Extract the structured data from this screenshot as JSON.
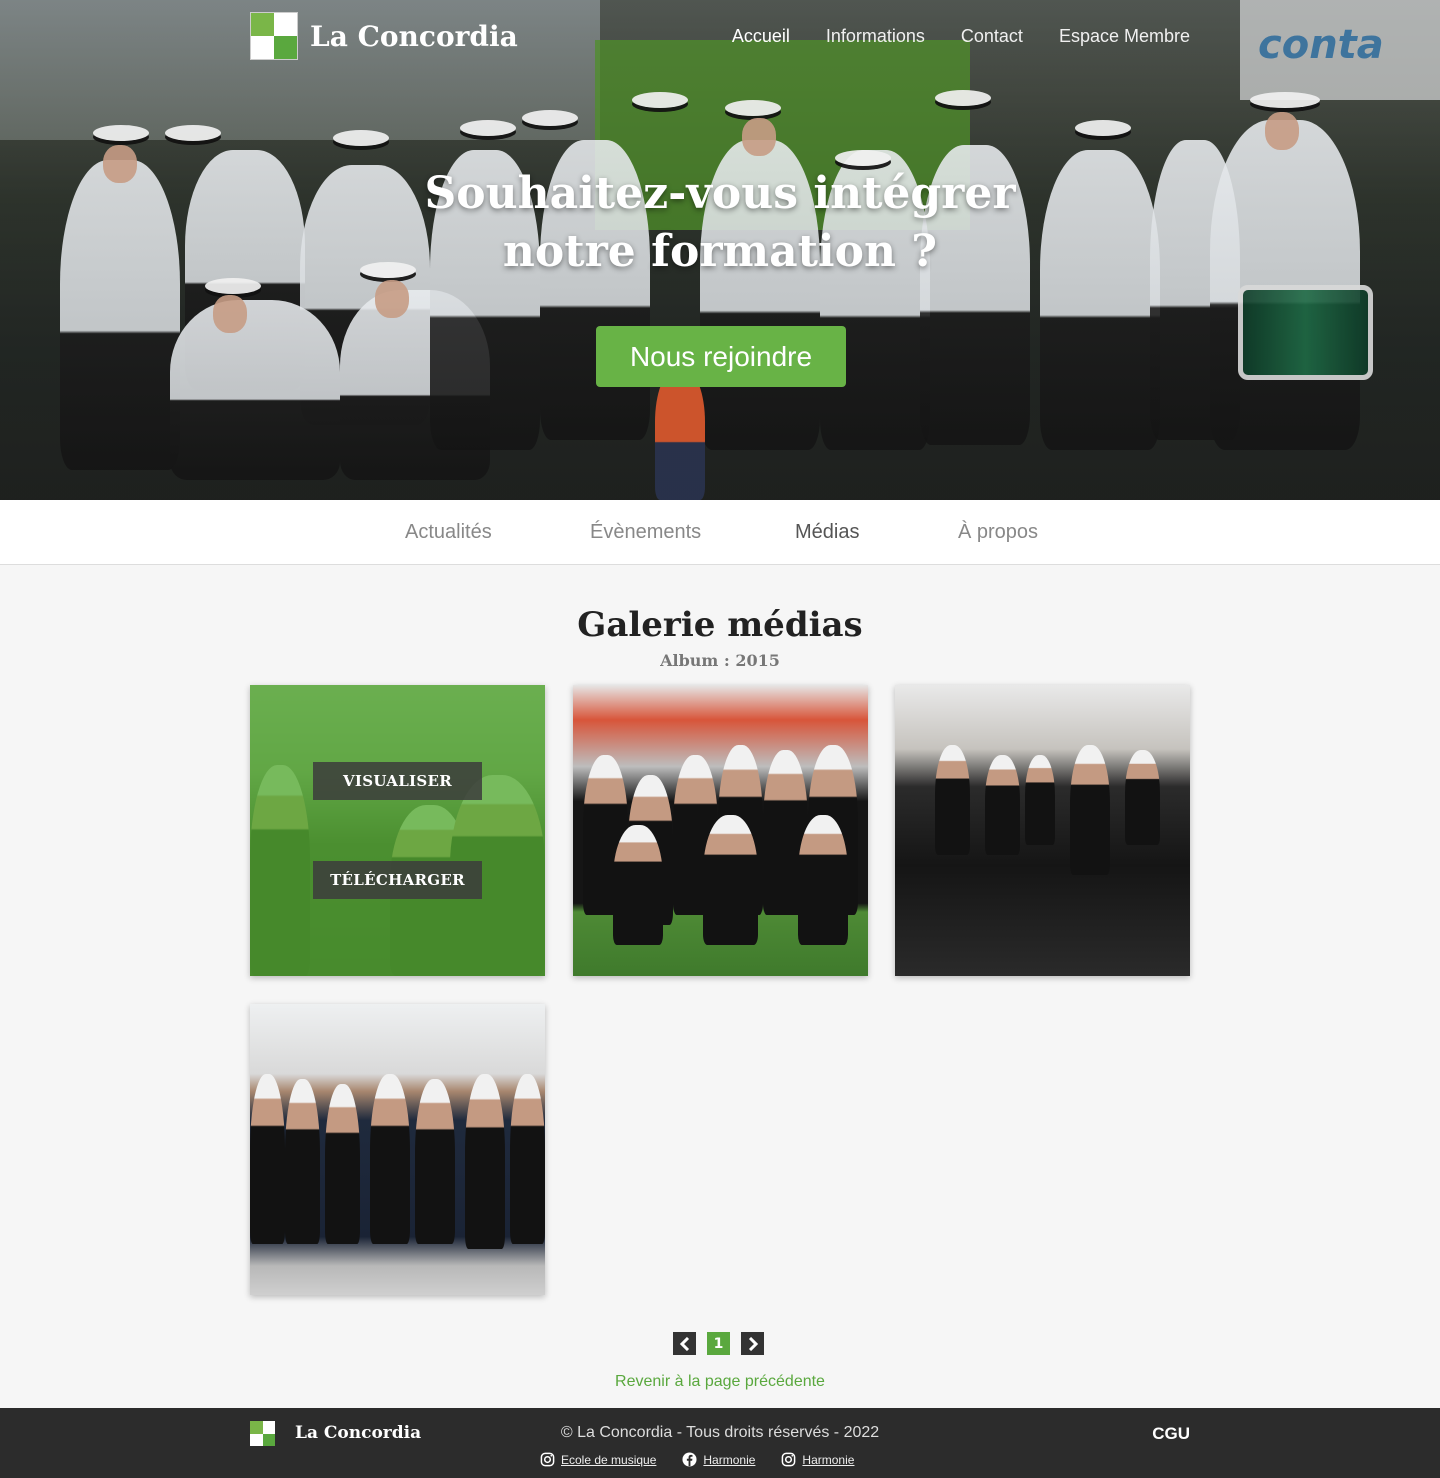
{
  "header": {
    "brand": "La Concordia",
    "nav": [
      "Accueil",
      "Informations",
      "Contact",
      "Espace Membre"
    ],
    "active_nav": "Accueil"
  },
  "hero": {
    "title_line1": "Souhaitez-vous intégrer",
    "title_line2": "notre formation ?",
    "cta": "Nous rejoindre"
  },
  "subnav": {
    "items": [
      "Actualités",
      "Évènements",
      "Médias",
      "À propos"
    ],
    "active": "Médias"
  },
  "gallery": {
    "title": "Galerie médias",
    "subtitle": "Album : 2015",
    "overlay_buttons": [
      "VISUALISER",
      "TÉLÉCHARGER"
    ]
  },
  "pagination": {
    "current_page": "1",
    "prev_icon": "chevron-left-icon",
    "next_icon": "chevron-right-icon",
    "back_link": "Revenir à la page précédente"
  },
  "footer": {
    "brand": "La Concordia",
    "copyright": "© La Concordia - Tous droits réservés - 2022",
    "cgu": "CGU",
    "links": [
      {
        "icon": "instagram-icon",
        "label": "Ecole de musique"
      },
      {
        "icon": "facebook-icon",
        "label": "Harmonie"
      },
      {
        "icon": "instagram-icon",
        "label": "Harmonie"
      }
    ]
  },
  "colors": {
    "accent": "#5aa83e",
    "cta": "#68b346",
    "footer_bg": "#2c2c2c"
  }
}
